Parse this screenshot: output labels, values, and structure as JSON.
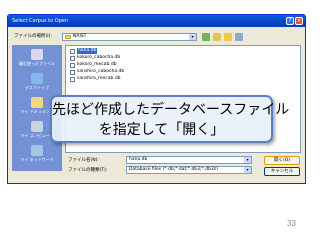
{
  "dialog": {
    "title": "Select Corpus to Open",
    "look_in_label": "ファイルの場所(I):",
    "look_in_value": "NAIST",
    "places": [
      {
        "label": "最近使ったファイル",
        "icon": "recent-icon",
        "color": "#d8d8f0"
      },
      {
        "label": "デスクトップ",
        "icon": "desktop-icon",
        "color": "#7fb6e8"
      },
      {
        "label": "マイ ドキュメント",
        "icon": "documents-icon",
        "color": "#f1d77b"
      },
      {
        "label": "マイ コンピュータ",
        "icon": "computer-icon",
        "color": "#c7d2e0"
      },
      {
        "label": "マイ ネットワーク",
        "icon": "network-icon",
        "color": "#9ec6e8"
      }
    ],
    "files": [
      "hana.db",
      "kokoro_cabocha.db",
      "kokoro_mecab.db",
      "sanshiro_cabocha.db",
      "sanshiro_mecab.db"
    ],
    "selected_file": "hana.db",
    "filename_label": "ファイル名(N):",
    "filename_value": "hana.db",
    "filetype_label": "ファイルの種類(T):",
    "filetype_value": "Database files (*.db;*.dat;*.db3;*.db3z)",
    "open_button": "開く(O)",
    "cancel_button": "キャンセル"
  },
  "callout": {
    "line1": "先ほど作成したデータベースファイル",
    "line2": "を指定して「開く」"
  },
  "page_number": "33",
  "colors": {
    "titlebar": "#0843c4",
    "callout_border": "#5b7fc4",
    "places_bar": "#6f8dd6"
  }
}
